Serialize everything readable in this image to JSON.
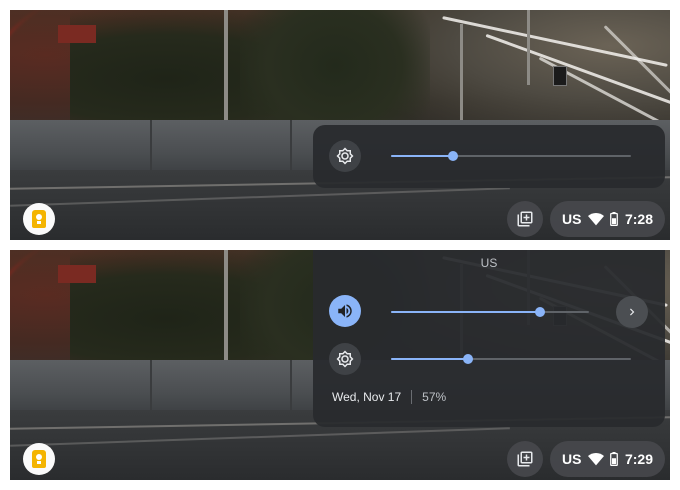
{
  "panels": [
    {
      "tray": {
        "language": "US",
        "time": "7:28"
      },
      "brightness": {
        "level": 0.26
      }
    },
    {
      "bubble": {
        "language": "US",
        "date": "Wed, Nov 17",
        "battery": "57%"
      },
      "volume": {
        "level": 0.75
      },
      "brightness": {
        "level": 0.32
      },
      "tray": {
        "language": "US",
        "time": "7:29"
      }
    }
  ],
  "icons": {
    "launcher": "keep-icon",
    "tray_button": "image-stack-icon",
    "wifi": "wifi-icon",
    "battery": "battery-icon",
    "brightness": "brightness-icon",
    "volume": "volume-icon",
    "more": "chevron-right-icon"
  },
  "colors": {
    "accent": "#8ab4f8",
    "bubble": "#282a2e",
    "keep": "#f4b400"
  }
}
